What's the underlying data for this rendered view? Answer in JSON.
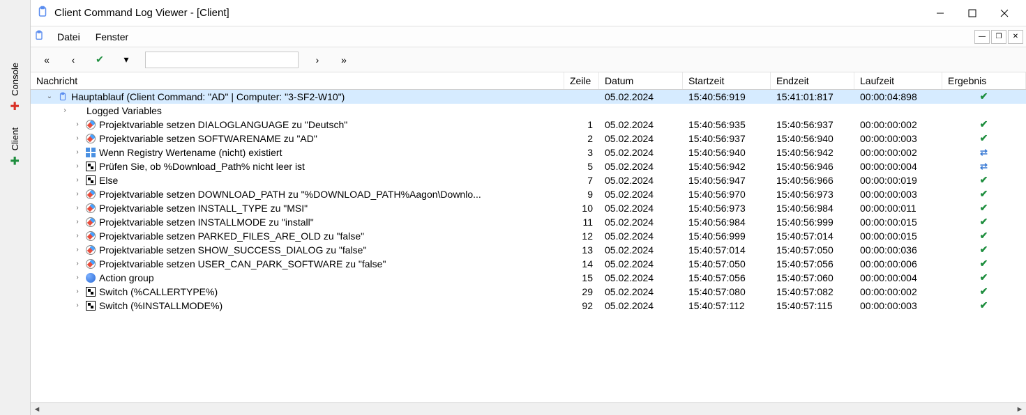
{
  "window": {
    "title": "Client Command Log Viewer - [Client]"
  },
  "menu": {
    "file": "Datei",
    "window": "Fenster"
  },
  "sidebar": {
    "console": "Console",
    "client": "Client"
  },
  "columns": {
    "message": "Nachricht",
    "line": "Zeile",
    "date": "Datum",
    "start": "Startzeit",
    "end": "Endzeit",
    "runtime": "Laufzeit",
    "result": "Ergebnis"
  },
  "rows": [
    {
      "indent": 0,
      "expander": "v",
      "icon": "clip",
      "msg": "Hauptablauf (Client Command: \"AD\" | Computer: \"3-SF2-W10\")",
      "line": "",
      "date": "05.02.2024",
      "start": "15:40:56:919",
      "end": "15:41:01:817",
      "run": "00:00:04:898",
      "res": "check",
      "selected": true
    },
    {
      "indent": 1,
      "expander": ">",
      "icon": "",
      "msg": "Logged Variables",
      "line": "",
      "date": "",
      "start": "",
      "end": "",
      "run": "",
      "res": ""
    },
    {
      "indent": 2,
      "expander": ">",
      "icon": "var",
      "msg": "Projektvariable setzen DIALOGLANGUAGE zu \"Deutsch\"",
      "line": "1",
      "date": "05.02.2024",
      "start": "15:40:56:935",
      "end": "15:40:56:937",
      "run": "00:00:00:002",
      "res": "check"
    },
    {
      "indent": 2,
      "expander": ">",
      "icon": "var",
      "msg": "Projektvariable setzen SOFTWARENAME zu \"AD\"",
      "line": "2",
      "date": "05.02.2024",
      "start": "15:40:56:937",
      "end": "15:40:56:940",
      "run": "00:00:00:003",
      "res": "check"
    },
    {
      "indent": 2,
      "expander": ">",
      "icon": "reg",
      "msg": "Wenn Registry Wertename (nicht) existiert",
      "line": "3",
      "date": "05.02.2024",
      "start": "15:40:56:940",
      "end": "15:40:56:942",
      "run": "00:00:00:002",
      "res": "blue"
    },
    {
      "indent": 2,
      "expander": ">",
      "icon": "branch",
      "msg": "Prüfen Sie, ob %Download_Path% nicht leer ist",
      "line": "5",
      "date": "05.02.2024",
      "start": "15:40:56:942",
      "end": "15:40:56:946",
      "run": "00:00:00:004",
      "res": "blue"
    },
    {
      "indent": 2,
      "expander": ">",
      "icon": "branch",
      "msg": "Else",
      "line": "7",
      "date": "05.02.2024",
      "start": "15:40:56:947",
      "end": "15:40:56:966",
      "run": "00:00:00:019",
      "res": "check"
    },
    {
      "indent": 2,
      "expander": ">",
      "icon": "var",
      "msg": "Projektvariable setzen DOWNLOAD_PATH zu \"%DOWNLOAD_PATH%Aagon\\Downlo...",
      "line": "9",
      "date": "05.02.2024",
      "start": "15:40:56:970",
      "end": "15:40:56:973",
      "run": "00:00:00:003",
      "res": "check"
    },
    {
      "indent": 2,
      "expander": ">",
      "icon": "var",
      "msg": "Projektvariable setzen INSTALL_TYPE zu \"MSI\"",
      "line": "10",
      "date": "05.02.2024",
      "start": "15:40:56:973",
      "end": "15:40:56:984",
      "run": "00:00:00:011",
      "res": "check"
    },
    {
      "indent": 2,
      "expander": ">",
      "icon": "var",
      "msg": "Projektvariable setzen INSTALLMODE zu \"install\"",
      "line": "11",
      "date": "05.02.2024",
      "start": "15:40:56:984",
      "end": "15:40:56:999",
      "run": "00:00:00:015",
      "res": "check"
    },
    {
      "indent": 2,
      "expander": ">",
      "icon": "var",
      "msg": "Projektvariable setzen PARKED_FILES_ARE_OLD zu \"false\"",
      "line": "12",
      "date": "05.02.2024",
      "start": "15:40:56:999",
      "end": "15:40:57:014",
      "run": "00:00:00:015",
      "res": "check"
    },
    {
      "indent": 2,
      "expander": ">",
      "icon": "var",
      "msg": "Projektvariable setzen SHOW_SUCCESS_DIALOG zu \"false\"",
      "line": "13",
      "date": "05.02.2024",
      "start": "15:40:57:014",
      "end": "15:40:57:050",
      "run": "00:00:00:036",
      "res": "check"
    },
    {
      "indent": 2,
      "expander": ">",
      "icon": "var",
      "msg": "Projektvariable setzen USER_CAN_PARK_SOFTWARE zu \"false\"",
      "line": "14",
      "date": "05.02.2024",
      "start": "15:40:57:050",
      "end": "15:40:57:056",
      "run": "00:00:00:006",
      "res": "check"
    },
    {
      "indent": 2,
      "expander": ">",
      "icon": "group",
      "msg": "Action group",
      "line": "15",
      "date": "05.02.2024",
      "start": "15:40:57:056",
      "end": "15:40:57:060",
      "run": "00:00:00:004",
      "res": "check"
    },
    {
      "indent": 2,
      "expander": ">",
      "icon": "branch",
      "msg": "Switch (%CALLERTYPE%)",
      "line": "29",
      "date": "05.02.2024",
      "start": "15:40:57:080",
      "end": "15:40:57:082",
      "run": "00:00:00:002",
      "res": "check"
    },
    {
      "indent": 2,
      "expander": ">",
      "icon": "branch",
      "msg": "Switch (%INSTALLMODE%)",
      "line": "92",
      "date": "05.02.2024",
      "start": "15:40:57:112",
      "end": "15:40:57:115",
      "run": "00:00:00:003",
      "res": "check"
    }
  ]
}
